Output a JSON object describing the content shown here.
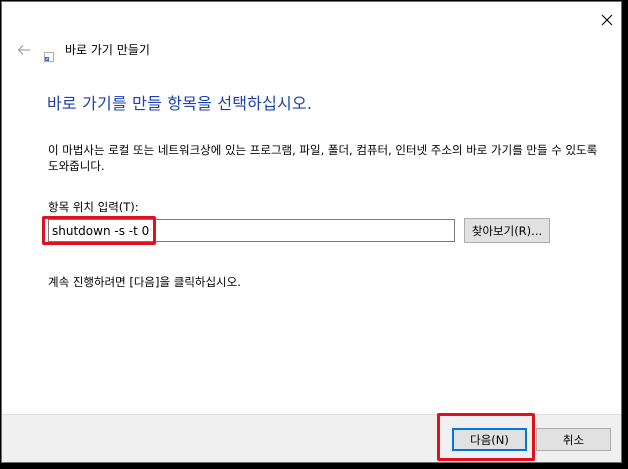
{
  "window": {
    "title": "바로 가기 만들기"
  },
  "wizard": {
    "heading": "바로 가기를 만들 항목을 선택하십시오.",
    "description": "이 마법사는 로컬 또는 네트워크상에 있는 프로그램, 파일, 폴더, 컴퓨터, 인터넷 주소의 바로 가기를 만들 수 있도록 도와줍니다.",
    "location_label": "항목 위치 입력(T):",
    "location_value": "shutdown -s -t 0",
    "browse_label": "찾아보기(R)...",
    "hint": "계속 진행하려면 [다음]을 클릭하십시오."
  },
  "footer": {
    "next_label": "다음(N)",
    "cancel_label": "취소"
  },
  "icons": {
    "close": "close-icon",
    "back": "back-arrow-icon",
    "app": "shortcut-icon"
  },
  "colors": {
    "heading": "#1e3fb0",
    "highlight": "#e01020",
    "focus_border": "#0078d7",
    "footer_bg": "#f0f0f0"
  }
}
